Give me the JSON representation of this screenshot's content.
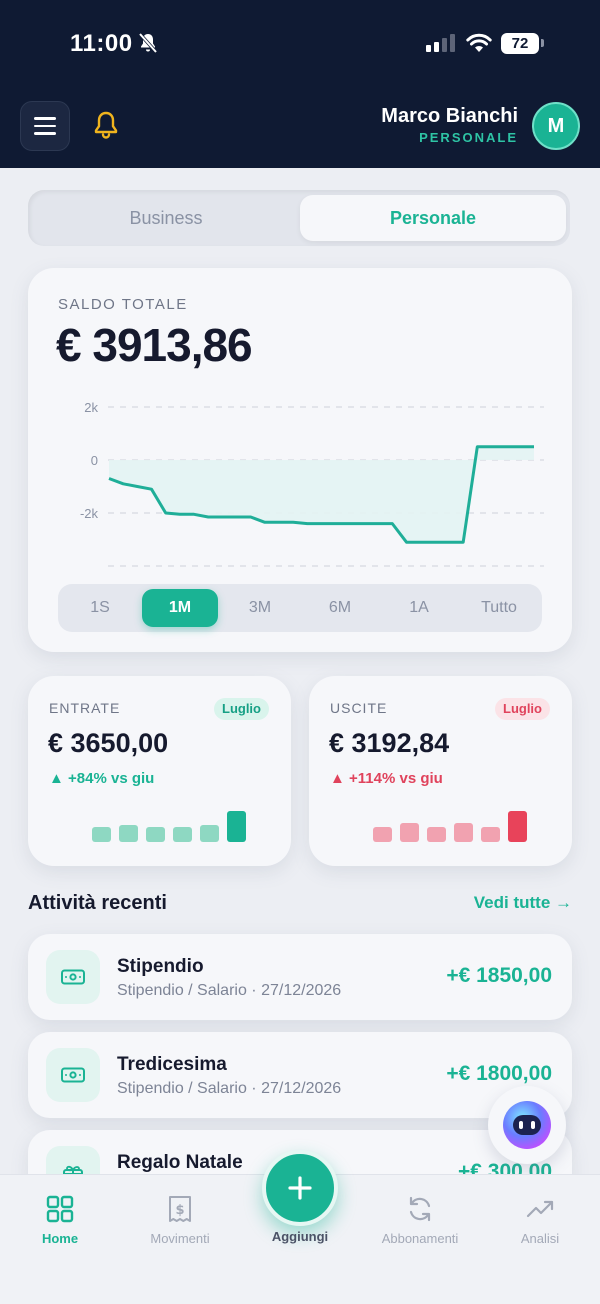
{
  "status_bar": {
    "time": "11:00",
    "battery": "72"
  },
  "header": {
    "user_name": "Marco Bianchi",
    "user_mode": "PERSONALE",
    "avatar_initial": "M"
  },
  "account_switch": {
    "options": [
      "Business",
      "Personale"
    ],
    "selected": "Personale"
  },
  "balance": {
    "label": "SALDO TOTALE",
    "value": "€ 3913,86"
  },
  "chart_data": {
    "type": "area",
    "y_ticks": [
      "2k",
      "0",
      "-2k"
    ],
    "ylim": [
      -4000,
      2000
    ],
    "x": [
      0,
      1,
      2,
      3,
      4,
      5,
      6,
      7,
      8,
      9,
      10,
      11,
      12,
      13,
      14,
      15,
      16,
      17,
      18,
      19,
      20,
      21,
      22,
      23,
      24,
      25,
      26,
      27,
      28,
      29,
      30
    ],
    "series": [
      {
        "values": [
          -700,
          -900,
          -1000,
          -1100,
          -2000,
          -2050,
          -2050,
          -2150,
          -2150,
          -2150,
          -2150,
          -2350,
          -2350,
          -2350,
          -2400,
          -2400,
          -2400,
          -2400,
          -2400,
          -2400,
          -2400,
          -3100,
          -3100,
          -3100,
          -3100,
          -3100,
          500,
          500,
          500,
          500,
          500
        ]
      }
    ],
    "fill_color": "#e3f3f3",
    "line_color": "#1fae98",
    "grid": true
  },
  "ranges": {
    "options": [
      "1S",
      "1M",
      "3M",
      "6M",
      "1A",
      "Tutto"
    ],
    "selected": "1M"
  },
  "income": {
    "label": "ENTRATE",
    "badge": "Luglio",
    "value": "€ 3650,00",
    "delta": "+84% vs giu",
    "bars": [
      0.45,
      0.5,
      0.45,
      0.45,
      0.5,
      0.9
    ],
    "bar_color": "#8ed8c2",
    "bar_active_color": "#1ab394"
  },
  "expenses": {
    "label": "USCITE",
    "badge": "Luglio",
    "value": "€ 3192,84",
    "delta": "+114% vs giu",
    "bars": [
      0.45,
      0.55,
      0.45,
      0.55,
      0.45,
      0.9
    ],
    "bar_color": "#f1a2b0",
    "bar_active_color": "#e8435a"
  },
  "recent": {
    "title": "Attività recenti",
    "see_all": "Vedi tutte →",
    "items": [
      {
        "title": "Stipendio",
        "subtitle": "Stipendio / Salario · 27/12/2026",
        "amount": "+€ 1850,00",
        "icon": "banknote-icon"
      },
      {
        "title": "Tredicesima",
        "subtitle": "Stipendio / Salario · 27/12/2026",
        "amount": "+€ 1800,00",
        "icon": "banknote-icon"
      },
      {
        "title": "Regalo Natale",
        "subtitle": "",
        "amount": "+€ 300,00",
        "icon": "gift-icon"
      }
    ]
  },
  "tabs": [
    {
      "label": "Home",
      "icon": "grid-icon",
      "active": true
    },
    {
      "label": "Movimenti",
      "icon": "receipt-icon"
    },
    {
      "label": "Aggiungi",
      "icon": "plus-icon"
    },
    {
      "label": "Abbonamenti",
      "icon": "refresh-icon"
    },
    {
      "label": "Analisi",
      "icon": "trend-icon"
    }
  ]
}
